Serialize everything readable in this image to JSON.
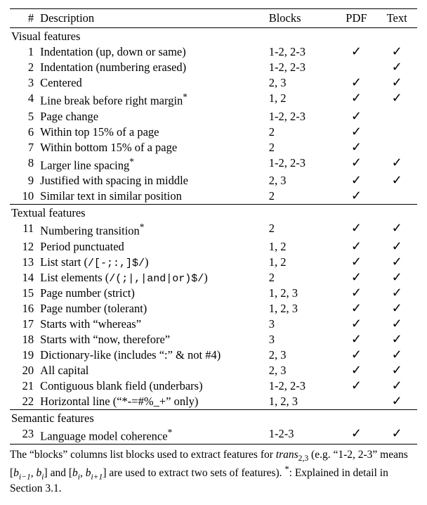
{
  "chart_data": {
    "type": "table",
    "title": "",
    "columns": [
      "#",
      "Description",
      "Blocks",
      "PDF",
      "Text"
    ],
    "sections": [
      {
        "name": "Visual features",
        "rows": [
          {
            "n": "1",
            "desc": "Indentation (up, down or same)",
            "blocks": "1-2, 2-3",
            "pdf": true,
            "text": true
          },
          {
            "n": "2",
            "desc": "Indentation (numbering erased)",
            "blocks": "1-2, 2-3",
            "pdf": false,
            "text": true
          },
          {
            "n": "3",
            "desc": "Centered",
            "blocks": "2, 3",
            "pdf": true,
            "text": true
          },
          {
            "n": "4",
            "desc": "Line break before right margin*",
            "mono": "",
            "blocks": "1, 2",
            "pdf": true,
            "text": true
          },
          {
            "n": "5",
            "desc": "Page change",
            "blocks": "1-2, 2-3",
            "pdf": true,
            "text": false
          },
          {
            "n": "6",
            "desc": "Within top 15% of a page",
            "blocks": "2",
            "pdf": true,
            "text": false
          },
          {
            "n": "7",
            "desc": "Within bottom 15% of a page",
            "blocks": "2",
            "pdf": true,
            "text": false
          },
          {
            "n": "8",
            "desc": "Larger line spacing*",
            "blocks": "1-2, 2-3",
            "pdf": true,
            "text": true
          },
          {
            "n": "9",
            "desc": "Justified with spacing in middle",
            "blocks": "2, 3",
            "pdf": true,
            "text": true
          },
          {
            "n": "10",
            "desc": "Similar text in similar position",
            "blocks": "2",
            "pdf": true,
            "text": false
          }
        ]
      },
      {
        "name": "Textual features",
        "rows": [
          {
            "n": "11",
            "desc": "Numbering transition*",
            "blocks": "2",
            "pdf": true,
            "text": true
          },
          {
            "n": "12",
            "desc": "Period punctuated",
            "blocks": "1, 2",
            "pdf": true,
            "text": true
          },
          {
            "n": "13",
            "desc": "List start (",
            "mono": "/[-;:,]$/",
            "desc2": ")",
            "blocks": "1, 2",
            "pdf": true,
            "text": true
          },
          {
            "n": "14",
            "desc": "List elements (",
            "mono": "/(;|,|and|or)$/",
            "desc2": ")",
            "blocks": "2",
            "pdf": true,
            "text": true
          },
          {
            "n": "15",
            "desc": "Page number (strict)",
            "blocks": "1, 2, 3",
            "pdf": true,
            "text": true
          },
          {
            "n": "16",
            "desc": "Page number (tolerant)",
            "blocks": "1, 2, 3",
            "pdf": true,
            "text": true
          },
          {
            "n": "17",
            "desc": "Starts with “whereas”",
            "blocks": "3",
            "pdf": true,
            "text": true
          },
          {
            "n": "18",
            "desc": "Starts with “now, therefore”",
            "blocks": "3",
            "pdf": true,
            "text": true
          },
          {
            "n": "19",
            "desc": "Dictionary-like (includes “:” & not #4)",
            "blocks": "2, 3",
            "pdf": true,
            "text": true
          },
          {
            "n": "20",
            "desc": "All capital",
            "blocks": "2, 3",
            "pdf": true,
            "text": true
          },
          {
            "n": "21",
            "desc": "Contiguous blank field (underbars)",
            "blocks": "1-2, 2-3",
            "pdf": true,
            "text": true
          },
          {
            "n": "22",
            "desc": "Horizontal line (“*-=#%_+” only)",
            "blocks": "1, 2, 3",
            "pdf": false,
            "text": true
          }
        ]
      },
      {
        "name": "Semantic features",
        "rows": [
          {
            "n": "23",
            "desc": "Language model coherence*",
            "blocks": "1-2-3",
            "pdf": true,
            "text": true
          }
        ]
      }
    ]
  },
  "header": {
    "num": "#",
    "desc": "Description",
    "blocks": "Blocks",
    "pdf": "PDF",
    "text": "Text"
  },
  "checkmark": "✓",
  "caption": {
    "line1a": "The “blocks” columns list blocks used to extract features for ",
    "trans": "trans",
    "sub": "2,3",
    "line1b": " (e.g. “1-2, 2-3” means [",
    "b1": "b",
    "i1": "i−1",
    "comma1": ", ",
    "b2": "b",
    "i2": "i",
    "line1c": "] and [",
    "b3": "b",
    "i3": "i",
    "comma2": ", ",
    "b4": "b",
    "i4": "i+1",
    "line1d": "] are used to extract two sets of features). ",
    "star": "*",
    "line1e": ": Explained in detail in Section 3.1."
  }
}
